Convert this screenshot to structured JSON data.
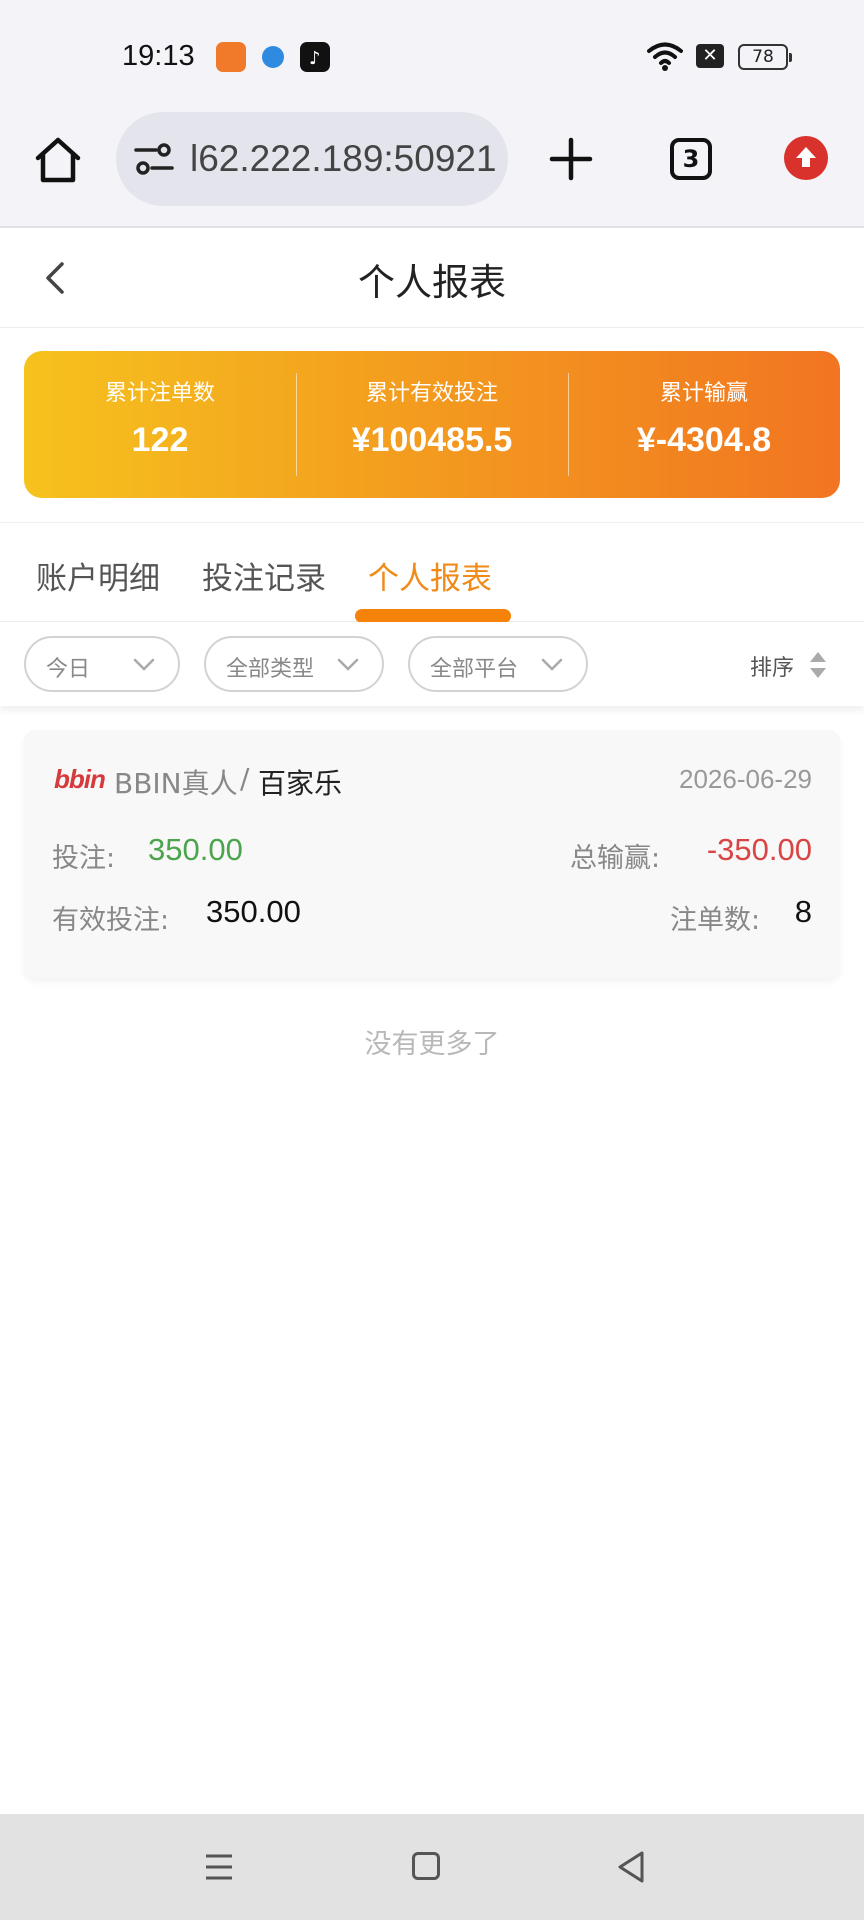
{
  "status_bar": {
    "time": "19:13",
    "battery": "78",
    "icons": [
      "notification-app-icon",
      "notification-browser-icon",
      "notification-tiktok-icon",
      "wifi-icon",
      "close-icon",
      "battery-icon"
    ]
  },
  "browser": {
    "url": "l62.222.189:50921",
    "tab_count": "3",
    "icons": [
      "home-icon",
      "site-settings-icon",
      "plus-icon",
      "tabs-icon",
      "upload-icon"
    ]
  },
  "header": {
    "title": "个人报表"
  },
  "summary": {
    "items": [
      {
        "label": "累计注单数",
        "value": "122"
      },
      {
        "label": "累计有效投注",
        "value": "¥100485.5"
      },
      {
        "label": "累计输赢",
        "value": "¥-4304.8"
      }
    ]
  },
  "tabs": {
    "items": [
      {
        "label": "账户明细"
      },
      {
        "label": "投注记录"
      },
      {
        "label": "个人报表"
      }
    ],
    "active": "个人报表"
  },
  "filters": {
    "date": "今日",
    "type": "全部类型",
    "platform": "全部平台",
    "sort_label": "排序"
  },
  "record": {
    "logo": "bbin",
    "platform": "BBIN真人",
    "separator": "/",
    "game": "百家乐",
    "date": "2026-06-29",
    "bet_label": "投注:",
    "bet_value": "350.00",
    "win_label": "总输赢:",
    "win_value": "-350.00",
    "valid_label": "有效投注:",
    "valid_value": "350.00",
    "count_label": "注单数:",
    "count_value": "8"
  },
  "footer": {
    "no_more": "没有更多了"
  },
  "colors": {
    "accent": "#f5830a",
    "gradient_start": "#f6c21d",
    "gradient_end": "#f27521",
    "positive": "#4ca44c",
    "negative": "#d94545"
  }
}
